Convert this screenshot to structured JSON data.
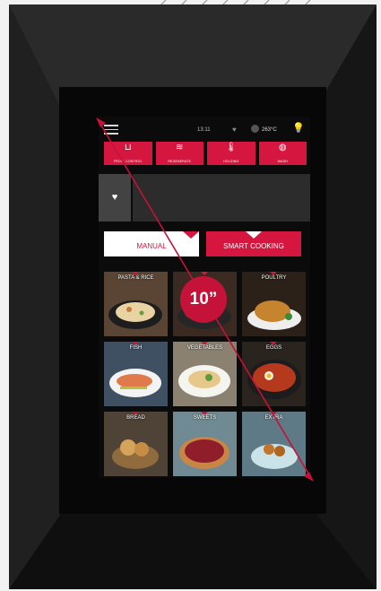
{
  "status": {
    "time": "13:11",
    "temperature": "263°C"
  },
  "modes": [
    {
      "icon": "pan-icon",
      "label": "PROG. CONTROL"
    },
    {
      "icon": "steam-icon",
      "label": "REGENERATE"
    },
    {
      "icon": "thermometer-icon",
      "label": "HOLDING"
    },
    {
      "icon": "wash-icon",
      "label": "WASH"
    }
  ],
  "favorites": {
    "icon": "heart-icon"
  },
  "tabs": {
    "manual": "MANUAL",
    "smart": "SMART COOKING"
  },
  "categories": [
    "PASTA & RICE",
    "",
    "POULTRY",
    "FISH",
    "VEGETABLES",
    "EGGS",
    "BREAD",
    "SWEETS",
    "EXTRA"
  ],
  "badge": "10”",
  "colors": {
    "accent": "#d5173f",
    "screen": "#0b0b0b",
    "bezel": "#1a1a1a"
  }
}
